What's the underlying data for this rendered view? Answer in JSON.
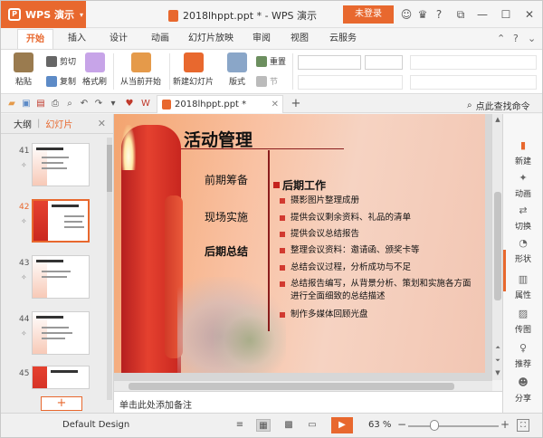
{
  "app": {
    "name": "WPS 演示",
    "doc_title": "2018lhppt.ppt * - WPS 演示",
    "login": "未登录"
  },
  "titlebar_icons": [
    "smiley-icon",
    "shirt-icon",
    "help-icon",
    "minimize-icon",
    "restore-icon",
    "maximize-icon",
    "close-icon"
  ],
  "menu": {
    "tabs": [
      "开始",
      "插入",
      "设计",
      "动画",
      "幻灯片放映",
      "审阅",
      "视图",
      "云服务"
    ],
    "active": "开始"
  },
  "ribbon": {
    "paste": "粘贴",
    "cut": "剪切",
    "copy": "复制",
    "format_painter": "格式刷",
    "from_current": "从当前开始",
    "new_slide": "新建幻灯片",
    "layout": "版式",
    "reset": "重置",
    "section": "节"
  },
  "quickbar": {
    "doc_tab": "2018lhppt.ppt *",
    "search": "点此查找命令"
  },
  "leftpanel": {
    "tab_outline": "大纲",
    "tab_slides": "幻灯片",
    "thumbs": [
      "41",
      "42",
      "43",
      "44",
      "45"
    ],
    "selected": "42",
    "add": "+"
  },
  "slide": {
    "title": "活动管理",
    "nav": [
      "前期筹备",
      "现场实施",
      "后期总结"
    ],
    "section_title": "后期工作",
    "bullets": [
      "摄影图片整理成册",
      "提供会议剩余资料、礼品的清单",
      "提供会议总结报告",
      "整理会议资料：邀请函、颁奖卡等",
      "总结会议过程，分析成功与不足",
      "总结报告编写，从背景分析、策划和实施各方面进行全面细致的总结描述",
      "制作多媒体回顾光盘"
    ]
  },
  "notes": {
    "placeholder": "单击此处添加备注"
  },
  "rightbar": [
    "新建",
    "动画",
    "切换",
    "形状",
    "属性",
    "传图",
    "推荐",
    "分享"
  ],
  "status": {
    "design": "Default Design",
    "zoom": "63 %"
  },
  "colors": {
    "accent": "#e8682e",
    "slide_red": "#c5231d"
  }
}
